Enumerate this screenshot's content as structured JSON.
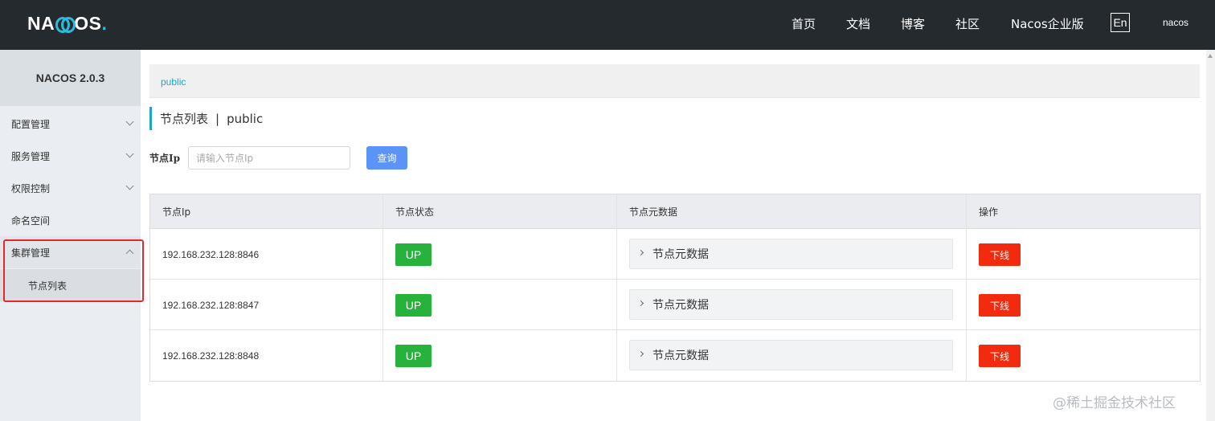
{
  "header": {
    "logo": {
      "n": "NA",
      "c": "C",
      "os": "OS",
      "dot": "."
    },
    "nav": [
      "首页",
      "文档",
      "博客",
      "社区",
      "Nacos企业版"
    ],
    "lang": "En",
    "user": "nacos"
  },
  "sidebar": {
    "version": "NACOS 2.0.3",
    "items": [
      "配置管理",
      "服务管理",
      "权限控制",
      "命名空间",
      "集群管理"
    ],
    "subitem": "节点列表"
  },
  "breadcrumb": "public",
  "title": {
    "main": "节点列表",
    "sep": "|",
    "namespace": "public"
  },
  "search": {
    "label": "节点Ip",
    "placeholder": "请输入节点Ip",
    "button": "查询"
  },
  "table": {
    "headers": [
      "节点Ip",
      "节点状态",
      "节点元数据",
      "操作"
    ],
    "rows": [
      {
        "ip": "192.168.232.128:8846",
        "status": "UP",
        "meta": "节点元数据",
        "action": "下线"
      },
      {
        "ip": "192.168.232.128:8847",
        "status": "UP",
        "meta": "节点元数据",
        "action": "下线"
      },
      {
        "ip": "192.168.232.128:8848",
        "status": "UP",
        "meta": "节点元数据",
        "action": "下线"
      }
    ]
  },
  "watermark": "@稀土掘金技术社区",
  "colors": {
    "topbar": "#252a2f",
    "accent": "#1ba7cc",
    "status_up": "#27b33b",
    "offline": "#f22b0e",
    "query": "#5b93f8"
  }
}
